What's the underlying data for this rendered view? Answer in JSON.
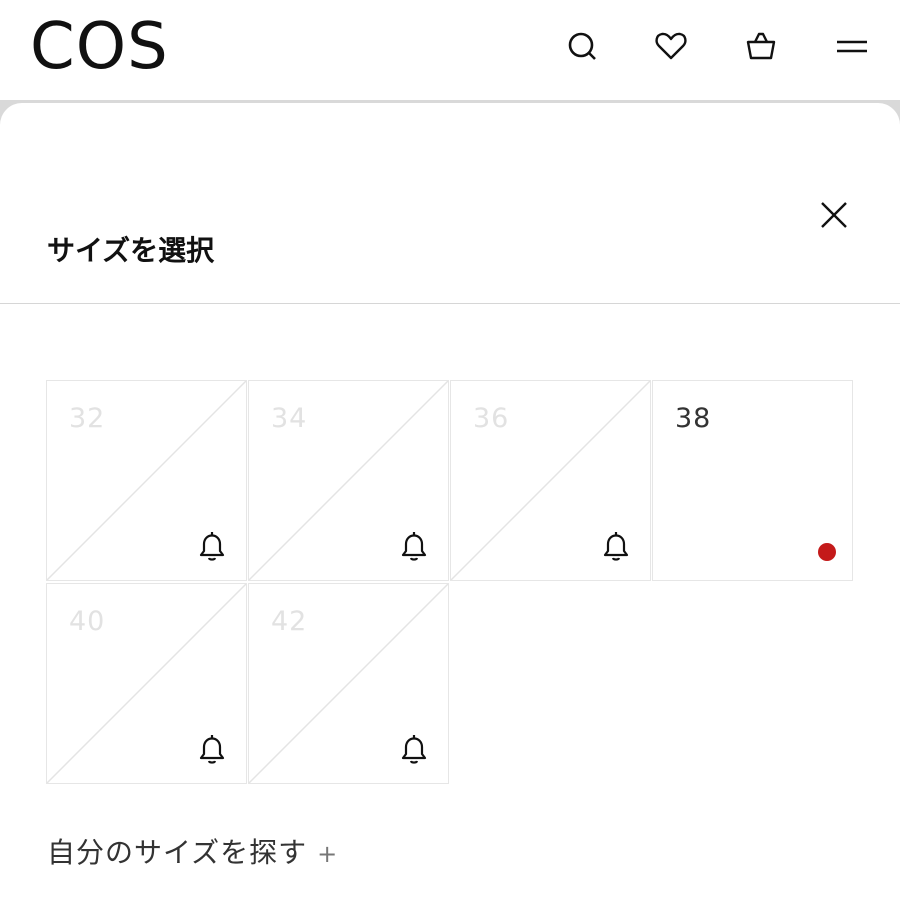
{
  "header": {
    "logo": "COS",
    "icons": [
      "search-icon",
      "heart-icon",
      "bag-icon",
      "menu-icon"
    ]
  },
  "size_sheet": {
    "title": "サイズを選択",
    "close_icon": "close-icon",
    "sizes": [
      {
        "label": "32",
        "available": false,
        "indicator": "bell-icon"
      },
      {
        "label": "34",
        "available": false,
        "indicator": "bell-icon"
      },
      {
        "label": "36",
        "available": false,
        "indicator": "bell-icon"
      },
      {
        "label": "38",
        "available": true,
        "indicator": "dot"
      },
      {
        "label": "40",
        "available": false,
        "indicator": "bell-icon"
      },
      {
        "label": "42",
        "available": false,
        "indicator": "bell-icon"
      }
    ],
    "find_size_label": "自分のサイズを探す",
    "find_size_plus": "+"
  },
  "colors": {
    "stock_dot": "#c41a1a",
    "backdrop": "#d9d9d9"
  }
}
